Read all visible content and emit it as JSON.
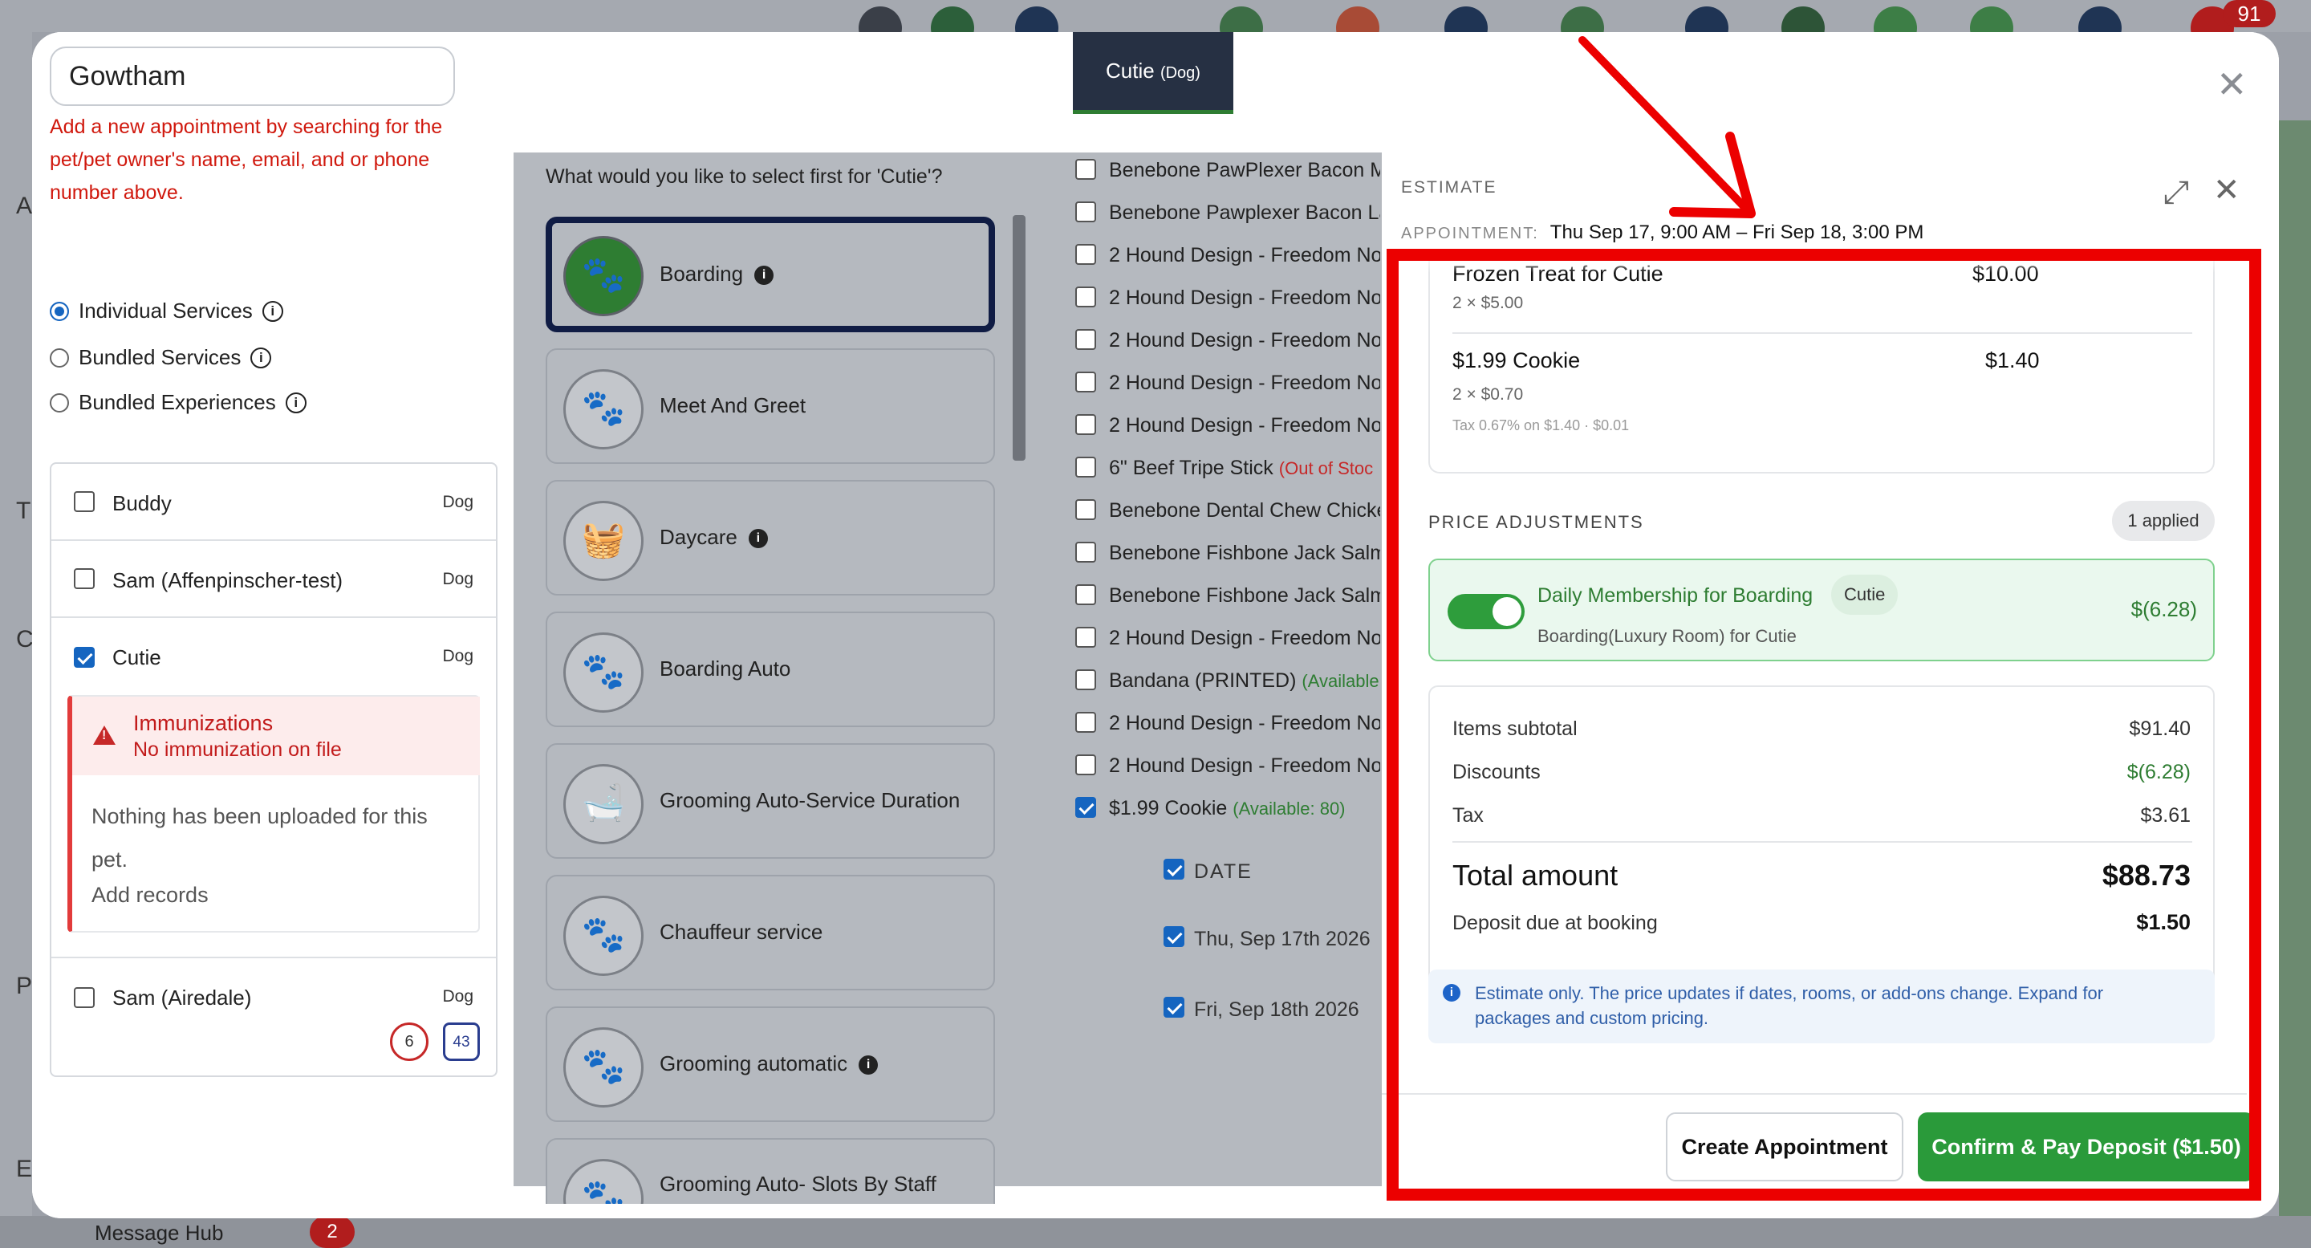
{
  "background": {
    "notification_count": "91",
    "sidebar_letters": [
      "A",
      "T",
      "C",
      "P",
      "E"
    ],
    "bottom_item": "Message Hub",
    "bottom_count": "2"
  },
  "left_panel": {
    "search_value": "Gowtham",
    "helper_text": "Add a new appointment by searching for the pet/pet owner's name, email, and or phone number above.",
    "service_modes": [
      {
        "label": "Individual Services",
        "selected": true
      },
      {
        "label": "Bundled Services",
        "selected": false
      },
      {
        "label": "Bundled Experiences",
        "selected": false
      }
    ],
    "pets": [
      {
        "name": "Buddy",
        "type": "Dog",
        "checked": false
      },
      {
        "name": "Sam (Affenpinscher-test)",
        "type": "Dog",
        "checked": false
      },
      {
        "name": "Cutie",
        "type": "Dog",
        "checked": true
      },
      {
        "name": "Sam (Airedale)",
        "type": "Dog",
        "checked": false
      }
    ],
    "immunization": {
      "title": "Immunizations",
      "subtitle": "No immunization on file",
      "body": "Nothing has been uploaded for this pet.",
      "link": "Add records"
    },
    "badges": {
      "visits": "6",
      "bag": "43"
    }
  },
  "tab": {
    "name": "Cutie",
    "species": "(Dog)"
  },
  "select_question": "What would you like to select first for 'Cutie'?",
  "services": [
    {
      "name": "Boarding",
      "info": true,
      "selected": true,
      "icon": "paw-icon"
    },
    {
      "name": "Meet And Greet",
      "info": false,
      "selected": false,
      "icon": "paw-icon"
    },
    {
      "name": "Daycare",
      "info": true,
      "selected": false,
      "icon": "daycare-icon"
    },
    {
      "name": "Boarding Auto",
      "info": false,
      "selected": false,
      "icon": "paw-icon"
    },
    {
      "name": "Grooming Auto-Service Duration",
      "info": false,
      "selected": false,
      "icon": "grooming-icon"
    },
    {
      "name": "Chauffeur service",
      "info": false,
      "selected": false,
      "icon": "paw-icon"
    },
    {
      "name": "Grooming automatic",
      "info": true,
      "selected": false,
      "icon": "paw-icon"
    },
    {
      "name": "Grooming Auto- Slots By Staff",
      "info": false,
      "selected": false,
      "icon": "paw-icon"
    }
  ],
  "products": [
    {
      "name": "Benebone PawPlexer Bacon M",
      "note": "",
      "note_type": "",
      "checked": false
    },
    {
      "name": "Benebone Pawplexer Bacon La",
      "note": "",
      "note_type": "",
      "checked": false
    },
    {
      "name": "2 Hound Design - Freedom No",
      "note": "",
      "note_type": "",
      "checked": false
    },
    {
      "name": "2 Hound Design - Freedom No",
      "note": "",
      "note_type": "",
      "checked": false
    },
    {
      "name": "2 Hound Design - Freedom No",
      "note": "",
      "note_type": "",
      "checked": false
    },
    {
      "name": "2 Hound Design - Freedom No",
      "note": "",
      "note_type": "",
      "checked": false
    },
    {
      "name": "2 Hound Design - Freedom No",
      "note": "",
      "note_type": "",
      "checked": false
    },
    {
      "name": "6\" Beef Tripe Stick",
      "note": "(Out of Stoc",
      "note_type": "bad",
      "checked": false
    },
    {
      "name": "Benebone Dental Chew Chicke",
      "note": "",
      "note_type": "",
      "checked": false
    },
    {
      "name": "Benebone Fishbone Jack Salmo",
      "note": "",
      "note_type": "",
      "checked": false
    },
    {
      "name": "Benebone Fishbone Jack Salmo",
      "note": "",
      "note_type": "",
      "checked": false
    },
    {
      "name": "2 Hound Design - Freedom No",
      "note": "",
      "note_type": "",
      "checked": false
    },
    {
      "name": "Bandana (PRINTED)",
      "note": "(Available:",
      "note_type": "ok",
      "checked": false
    },
    {
      "name": "2 Hound Design - Freedom No",
      "note": "",
      "note_type": "",
      "checked": false
    },
    {
      "name": "2 Hound Design - Freedom No",
      "note": "",
      "note_type": "",
      "checked": false
    },
    {
      "name": "$1.99 Cookie",
      "note": "(Available: 80)",
      "note_type": "ok",
      "checked": true
    }
  ],
  "dates": {
    "header": "DATE",
    "rows": [
      "Thu, Sep 17th 2026",
      "Fri, Sep 18th 2026"
    ]
  },
  "estimate": {
    "title": "ESTIMATE",
    "appointment_label": "APPOINTMENT:",
    "appointment_value": "Thu Sep 17, 9:00 AM – Fri Sep 18, 3:00 PM",
    "items": [
      {
        "name": "Frozen Treat for Cutie",
        "sub": "2 × $5.00",
        "amount": "$10.00",
        "tax": ""
      },
      {
        "name": "$1.99 Cookie",
        "sub": "2 × $0.70",
        "amount": "$1.40",
        "tax": "Tax 0.67% on $1.40 · $0.01"
      }
    ],
    "adjustments_title": "PRICE ADJUSTMENTS",
    "applied_badge": "1 applied",
    "adjustment": {
      "name": "Daily Membership for Boarding",
      "pet": "Cutie",
      "sub": "Boarding(Luxury Room) for Cutie",
      "amount": "$(6.28)",
      "enabled": true
    },
    "summary": {
      "subtotal_label": "Items subtotal",
      "subtotal": "$91.40",
      "discounts_label": "Discounts",
      "discounts": "$(6.28)",
      "tax_label": "Tax",
      "tax": "$3.61",
      "total_label": "Total amount",
      "total": "$88.73",
      "deposit_label": "Deposit due at booking",
      "deposit": "$1.50"
    },
    "note": "Estimate only. The price updates if dates, rooms, or add-ons change. Expand for packages and custom pricing.",
    "create_button": "Create Appointment",
    "confirm_button": "Confirm & Pay Deposit ($1.50)"
  },
  "colors": {
    "accent_green": "#2a9a3a",
    "navy": "#101c44",
    "highlight_red": "#ec0000"
  }
}
